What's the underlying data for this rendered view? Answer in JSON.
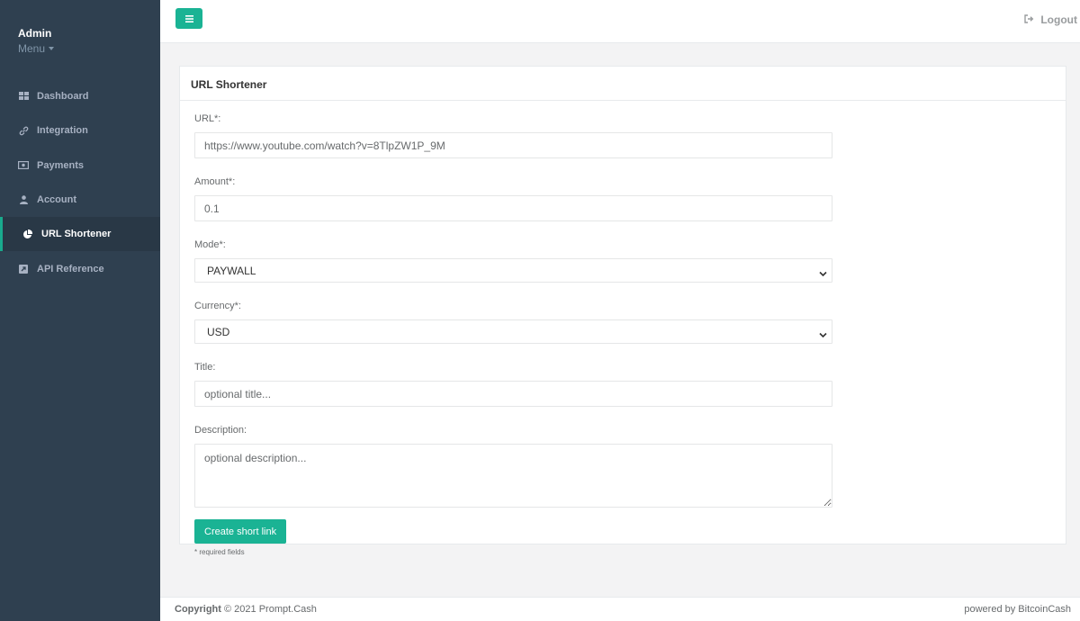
{
  "sidebar": {
    "profile_name": "Admin",
    "profile_menu": "Menu",
    "items": [
      {
        "label": "Dashboard",
        "icon": "grid-icon"
      },
      {
        "label": "Integration",
        "icon": "link-icon"
      },
      {
        "label": "Payments",
        "icon": "money-icon"
      },
      {
        "label": "Account",
        "icon": "user-icon"
      },
      {
        "label": "URL Shortener",
        "icon": "pie-chart-icon",
        "active": true
      },
      {
        "label": "API Reference",
        "icon": "external-link-icon"
      }
    ]
  },
  "topbar": {
    "logout_label": "Logout"
  },
  "panel": {
    "title": "URL Shortener",
    "url_label": "URL*:",
    "url_value": "https://www.youtube.com/watch?v=8TlpZW1P_9M",
    "amount_label": "Amount*:",
    "amount_value": "0.1",
    "mode_label": "Mode*:",
    "mode_value": "PAYWALL",
    "currency_label": "Currency*:",
    "currency_value": "USD",
    "title_label": "Title:",
    "title_placeholder": "optional title...",
    "description_label": "Description:",
    "description_placeholder": "optional description...",
    "submit_label": "Create short link",
    "required_note": "* required fields"
  },
  "footer": {
    "copyright_bold": "Copyright",
    "copyright_rest": "© 2021 Prompt.Cash",
    "powered_by": "powered by BitcoinCash"
  },
  "colors": {
    "sidebar_bg": "#2f4050",
    "accent": "#1ab394"
  }
}
